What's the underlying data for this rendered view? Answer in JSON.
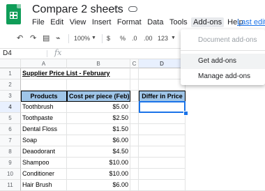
{
  "app": {
    "doc_title": "Compare 2 sheets",
    "menus": [
      "File",
      "Edit",
      "View",
      "Insert",
      "Format",
      "Data",
      "Tools",
      "Add-ons",
      "Help"
    ],
    "last_edit": "Last edit"
  },
  "toolbar": {
    "undo_icon": "undo-icon",
    "redo_icon": "redo-icon",
    "zoom": "100%",
    "currency": "$",
    "percent": "%",
    "dec_decrease": ".0",
    "dec_increase": ".00",
    "more_formats": "123"
  },
  "formula_bar": {
    "cell_ref": "D4",
    "fx": "fx",
    "value": ""
  },
  "columns": [
    "A",
    "B",
    "C",
    "D"
  ],
  "rows": [
    "1",
    "2",
    "3",
    "4",
    "5",
    "6",
    "7",
    "8",
    "9",
    "10",
    "11"
  ],
  "sheet": {
    "title": "Supplier Price List - February",
    "headers": {
      "products": "Products",
      "cost": "Cost per piece (Feb)",
      "differ": "Differ in Price"
    },
    "items": [
      {
        "product": "Toothbrush",
        "cost": "$5.00"
      },
      {
        "product": "Toothpaste",
        "cost": "$2.50"
      },
      {
        "product": "Dental Floss",
        "cost": "$1.50"
      },
      {
        "product": "Soap",
        "cost": "$6.00"
      },
      {
        "product": "Deaodorant",
        "cost": "$4.50"
      },
      {
        "product": "Shampoo",
        "cost": "$10.00"
      },
      {
        "product": "Conditioner",
        "cost": "$10.00"
      },
      {
        "product": "Hair Brush",
        "cost": "$6.00"
      }
    ]
  },
  "addons_menu": {
    "items": [
      "Document add-ons",
      "Get add-ons",
      "Manage add-ons"
    ]
  },
  "colors": {
    "accent": "#1a73e8",
    "header_fill": "#9fc5e8",
    "brand": "#0f9d58"
  }
}
